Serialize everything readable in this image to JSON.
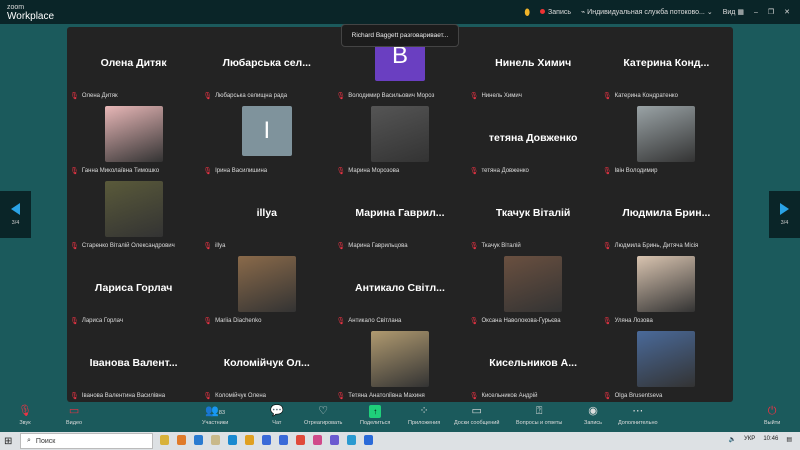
{
  "app": {
    "logo_small": "zoom",
    "logo_big": "Workplace",
    "recording": "Запись",
    "stream": "Индивидуальная служба потоково...",
    "view": "Вид"
  },
  "toast": "Richard Baggett разговаривает...",
  "page_indicator": "3/4",
  "colors": {
    "accent": "#2aa3e6",
    "muted": "#e33344",
    "share": "#1fd07a",
    "stage": "#232323",
    "background": "#1b5a5c"
  },
  "tiles": [
    {
      "title": "Олена Дитяк",
      "label": "Олена Дитяк"
    },
    {
      "title": "Любарська  сел...",
      "label": "Любарська селищна рада"
    },
    {
      "avatar": "B",
      "avatar_color": "#6a3fc1",
      "label": "Володимир Васильович Мороз"
    },
    {
      "title": "Нинель Химич",
      "label": "Нинель Химич"
    },
    {
      "title": "Катерина  Конд...",
      "label": "Катерина Кондратенко"
    },
    {
      "photo": "#e8b7b7",
      "label": "Ганна Миколаївна Тимошко"
    },
    {
      "avatar": "I",
      "avatar_color": "#7f939c",
      "label": "Ірина Василишина"
    },
    {
      "photo": "#555555",
      "label": "Марина Морозова"
    },
    {
      "title": "тетяна Довженко",
      "label": "тетяна Довженко"
    },
    {
      "photo": "#9aa3a6",
      "label": "Івін Володимир"
    },
    {
      "photo": "#5a5a3a",
      "label": "Старенко Віталій Олександрович"
    },
    {
      "title": "illya",
      "label": "illya"
    },
    {
      "title": "Марина  Гаврил...",
      "label": "Марина Гаврильцова"
    },
    {
      "title": "Ткачук Віталій",
      "label": "Ткачук Віталій"
    },
    {
      "title": "Людмила  Брин...",
      "label": "Людмила Бринь, Дитяча Місія"
    },
    {
      "title": "Лариса Горлач",
      "label": "Лариса Горлач"
    },
    {
      "photo": "#8a6a4a",
      "label": "Mariia Diachenko"
    },
    {
      "title": "Антикало  Світл...",
      "label": "Антикало Світлана"
    },
    {
      "photo": "#6a5040",
      "label": "Оксана Наволокова-Гурьєва"
    },
    {
      "photo": "#d9c4b0",
      "label": "Уляна Лозова"
    },
    {
      "title": "Іванова  Валент...",
      "label": "Іванова Валентина Василівна"
    },
    {
      "title": "Коломійчук  Ол...",
      "label": "Коломійчук Олена"
    },
    {
      "photo": "#b09a70",
      "label": "Тетяна Анатоліївна Махиня"
    },
    {
      "title": "Кисельников  А...",
      "label": "Кисельников Андрій"
    },
    {
      "photo": "#4a6a9a",
      "label": "Olga Brusentseva"
    }
  ],
  "toolbar": {
    "audio": "Звук",
    "video": "Видео",
    "participants": "Участники",
    "participants_count": "83",
    "chat": "Чат",
    "react": "Отреагировать",
    "share": "Поделиться",
    "apps": "Приложения",
    "whiteboards": "Доски сообщений",
    "qa": "Вопросы и ответы",
    "record": "Запись",
    "more": "Дополнительно",
    "leave": "Выйти"
  },
  "taskbar": {
    "search": "Поиск",
    "lang": "УКР",
    "time": "10:46"
  }
}
